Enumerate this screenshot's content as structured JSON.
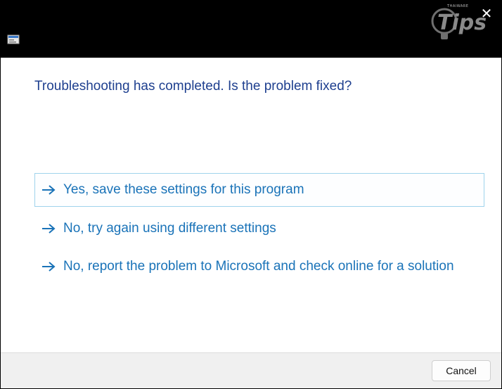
{
  "titlebar": {
    "app_icon": "troubleshooter-icon",
    "close_icon": "close-icon",
    "close_symbol": "✕",
    "watermark": {
      "brand_text": "Tips",
      "small_text": "THAIWARE"
    }
  },
  "main": {
    "question": "Troubleshooting has completed.  Is the problem fixed?",
    "options": [
      {
        "label": "Yes, save these settings for this program",
        "selected": true
      },
      {
        "label": "No, try again using different settings",
        "selected": false
      },
      {
        "label": "No, report the problem to Microsoft and check online for a solution",
        "selected": false
      }
    ],
    "option_icon": "arrow-right-icon"
  },
  "footer": {
    "cancel_label": "Cancel"
  },
  "colors": {
    "question_text": "#1e3f8f",
    "option_text": "#1a73b8",
    "selected_border": "#9fd3ec",
    "footer_bg": "#f0f0f0"
  }
}
